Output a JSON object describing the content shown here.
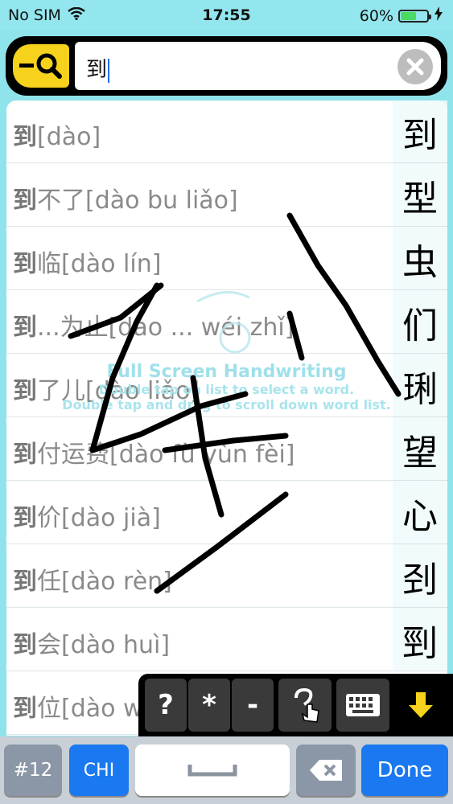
{
  "status": {
    "carrier": "No SIM",
    "time": "17:55",
    "battery": "60%",
    "battery_level": 0.6
  },
  "search": {
    "value": "到"
  },
  "list": [
    {
      "head": "到",
      "rest": "[dào]"
    },
    {
      "head": "到",
      "rest": "不了[dào bu liǎo]"
    },
    {
      "head": "到",
      "rest": "临[dào lín]"
    },
    {
      "head": "到",
      "rest": "...为止[dào ... wéi zhǐ]"
    },
    {
      "head": "到",
      "rest": "了儿[dào liǎo]"
    },
    {
      "head": "到",
      "rest": "付运费[dào fù yùn fèi]"
    },
    {
      "head": "到",
      "rest": "价[dào jià]"
    },
    {
      "head": "到",
      "rest": "任[dào rèn]"
    },
    {
      "head": "到",
      "rest": "会[dào huì]"
    },
    {
      "head": "到",
      "rest": "位[dào w"
    }
  ],
  "candidates": [
    "到",
    "型",
    "虫",
    "们",
    "琍",
    "望",
    "心",
    "刭",
    "剄"
  ],
  "hint": {
    "title": "Full Screen Handwriting",
    "line1": "Double tap on list to select a word.",
    "line2": "Double tap and drag to scroll down word list."
  },
  "toolbar": {
    "question": "?",
    "star": "*",
    "dash": "-"
  },
  "keyboard": {
    "num": "#12",
    "lang": "CHI",
    "done": "Done"
  },
  "colors": {
    "accent_yellow": "#f6d21c",
    "key_blue": "#1a79f0",
    "background": "#93e6ee"
  }
}
